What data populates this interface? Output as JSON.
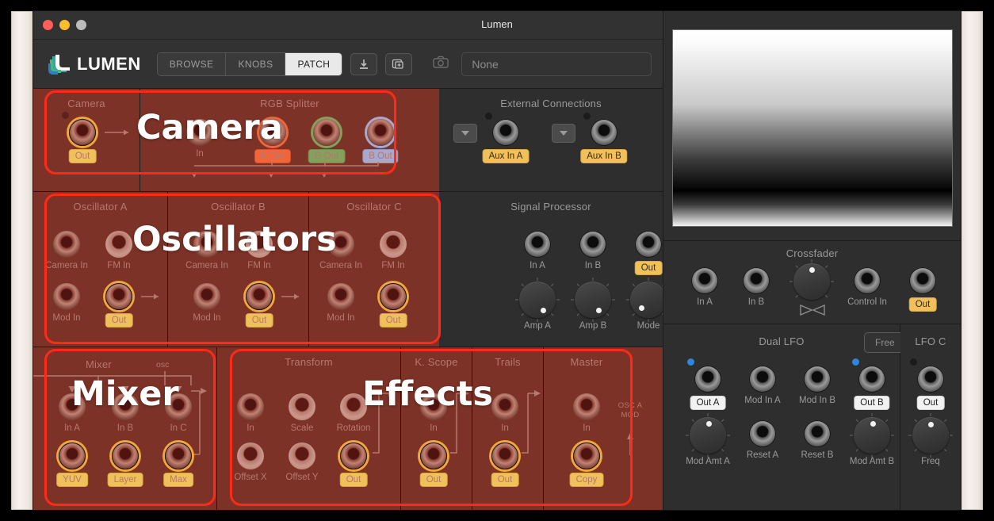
{
  "window": {
    "title": "Lumen"
  },
  "toolbar": {
    "brand": "LUMEN",
    "segments": [
      {
        "label": "BROWSE",
        "active": false
      },
      {
        "label": "KNOBS",
        "active": false
      },
      {
        "label": "PATCH",
        "active": true
      }
    ],
    "icons": [
      "download-icon",
      "add-image-icon",
      "camera-icon"
    ],
    "patch_field_value": "None",
    "patch_field_placeholder": "None"
  },
  "highlights": [
    {
      "label": "Camera"
    },
    {
      "label": "Oscillators"
    },
    {
      "label": "Mixer"
    },
    {
      "label": "Effects"
    }
  ],
  "panels": {
    "camera": {
      "title": "Camera",
      "jacks": [
        {
          "label": "Out",
          "style": "pill-amber"
        }
      ]
    },
    "rgb_splitter": {
      "title": "RGB Splitter",
      "jacks": [
        {
          "label": "In",
          "style": "plain"
        },
        {
          "label": "R Out",
          "style": "pill-red"
        },
        {
          "label": "G Out",
          "style": "pill-green"
        },
        {
          "label": "B Out",
          "style": "pill-blue"
        }
      ]
    },
    "external_connections": {
      "title": "External Connections",
      "jacks": [
        {
          "label": "Aux In A",
          "style": "pill-amber"
        },
        {
          "label": "Aux In B",
          "style": "pill-amber"
        }
      ],
      "selectors": [
        "chevron-down-icon",
        "chevron-down-icon"
      ]
    },
    "oscillator_a": {
      "title": "Oscillator A",
      "jacks": [
        {
          "label": "Camera In"
        },
        {
          "label": "FM In"
        },
        {
          "label": "Mod In"
        },
        {
          "label": "Out",
          "style": "pill-amber"
        }
      ]
    },
    "oscillator_b": {
      "title": "Oscillator B",
      "jacks": [
        {
          "label": "Camera In"
        },
        {
          "label": "FM In"
        },
        {
          "label": "Mod In"
        },
        {
          "label": "Out",
          "style": "pill-amber"
        }
      ]
    },
    "oscillator_c": {
      "title": "Oscillator C",
      "jacks": [
        {
          "label": "Camera In"
        },
        {
          "label": "FM In"
        },
        {
          "label": "Mod In"
        },
        {
          "label": "Out",
          "style": "pill-amber"
        }
      ]
    },
    "signal_processor": {
      "title": "Signal Processor",
      "jacks": [
        {
          "label": "In A"
        },
        {
          "label": "In B"
        },
        {
          "label": "Out",
          "style": "pill-amber"
        }
      ],
      "knobs": [
        {
          "label": "Amp A"
        },
        {
          "label": "Amp B"
        },
        {
          "label": "Mode"
        }
      ]
    },
    "mixer": {
      "title": "Mixer",
      "source_label": "osc",
      "jacks": [
        {
          "label": "In A"
        },
        {
          "label": "In B"
        },
        {
          "label": "In C"
        },
        {
          "label": "YUV",
          "style": "pill-amber"
        },
        {
          "label": "Layer",
          "style": "pill-amber"
        },
        {
          "label": "Max",
          "style": "pill-amber"
        }
      ]
    },
    "transform": {
      "title": "Transform",
      "jacks": [
        {
          "label": "In"
        },
        {
          "label": "Scale"
        },
        {
          "label": "Rotation"
        },
        {
          "label": "Offset X"
        },
        {
          "label": "Offset Y"
        },
        {
          "label": "Out",
          "style": "pill-amber"
        }
      ]
    },
    "kscope": {
      "title": "K. Scope",
      "jacks": [
        {
          "label": "In"
        },
        {
          "label": "Out",
          "style": "pill-amber"
        }
      ]
    },
    "trails": {
      "title": "Trails",
      "jacks": [
        {
          "label": "In"
        },
        {
          "label": "Out",
          "style": "pill-amber"
        }
      ]
    },
    "master": {
      "title": "Master",
      "note": "OSC A MOD",
      "jacks": [
        {
          "label": "In"
        },
        {
          "label": "Copy",
          "style": "pill-amber"
        }
      ]
    },
    "crossfader": {
      "title": "Crossfader",
      "jacks": [
        {
          "label": "In A"
        },
        {
          "label": "In B"
        },
        {
          "label": "Control In"
        },
        {
          "label": "Out",
          "style": "pill-amber"
        }
      ],
      "knob": {
        "label": ""
      },
      "glyph": "bowtie-icon"
    },
    "dual_lfo": {
      "title": "Dual LFO",
      "mode_button": "Free",
      "jacks": [
        {
          "label": "Out A",
          "style": "pill-white"
        },
        {
          "label": "Mod In A"
        },
        {
          "label": "Mod In B"
        },
        {
          "label": "Out B",
          "style": "pill-white"
        },
        {
          "label": "Reset A"
        },
        {
          "label": "Reset B"
        }
      ],
      "knobs": [
        {
          "label": "Mod Amt A"
        },
        {
          "label": "Mod Amt B"
        }
      ]
    },
    "lfo_c": {
      "title": "LFO C",
      "jacks": [
        {
          "label": "Out",
          "style": "pill-white"
        }
      ],
      "knobs": [
        {
          "label": "Freq"
        }
      ]
    }
  },
  "colors": {
    "highlight": "#ff2a18",
    "module_red": "#7c3226",
    "panel_dark": "#2e2e2e",
    "amber": "#f0c05c",
    "r_out": "#f0653a",
    "g_out": "#83a05c",
    "b_out": "#a9a8cd",
    "lfo_led": "#2f86e0"
  }
}
